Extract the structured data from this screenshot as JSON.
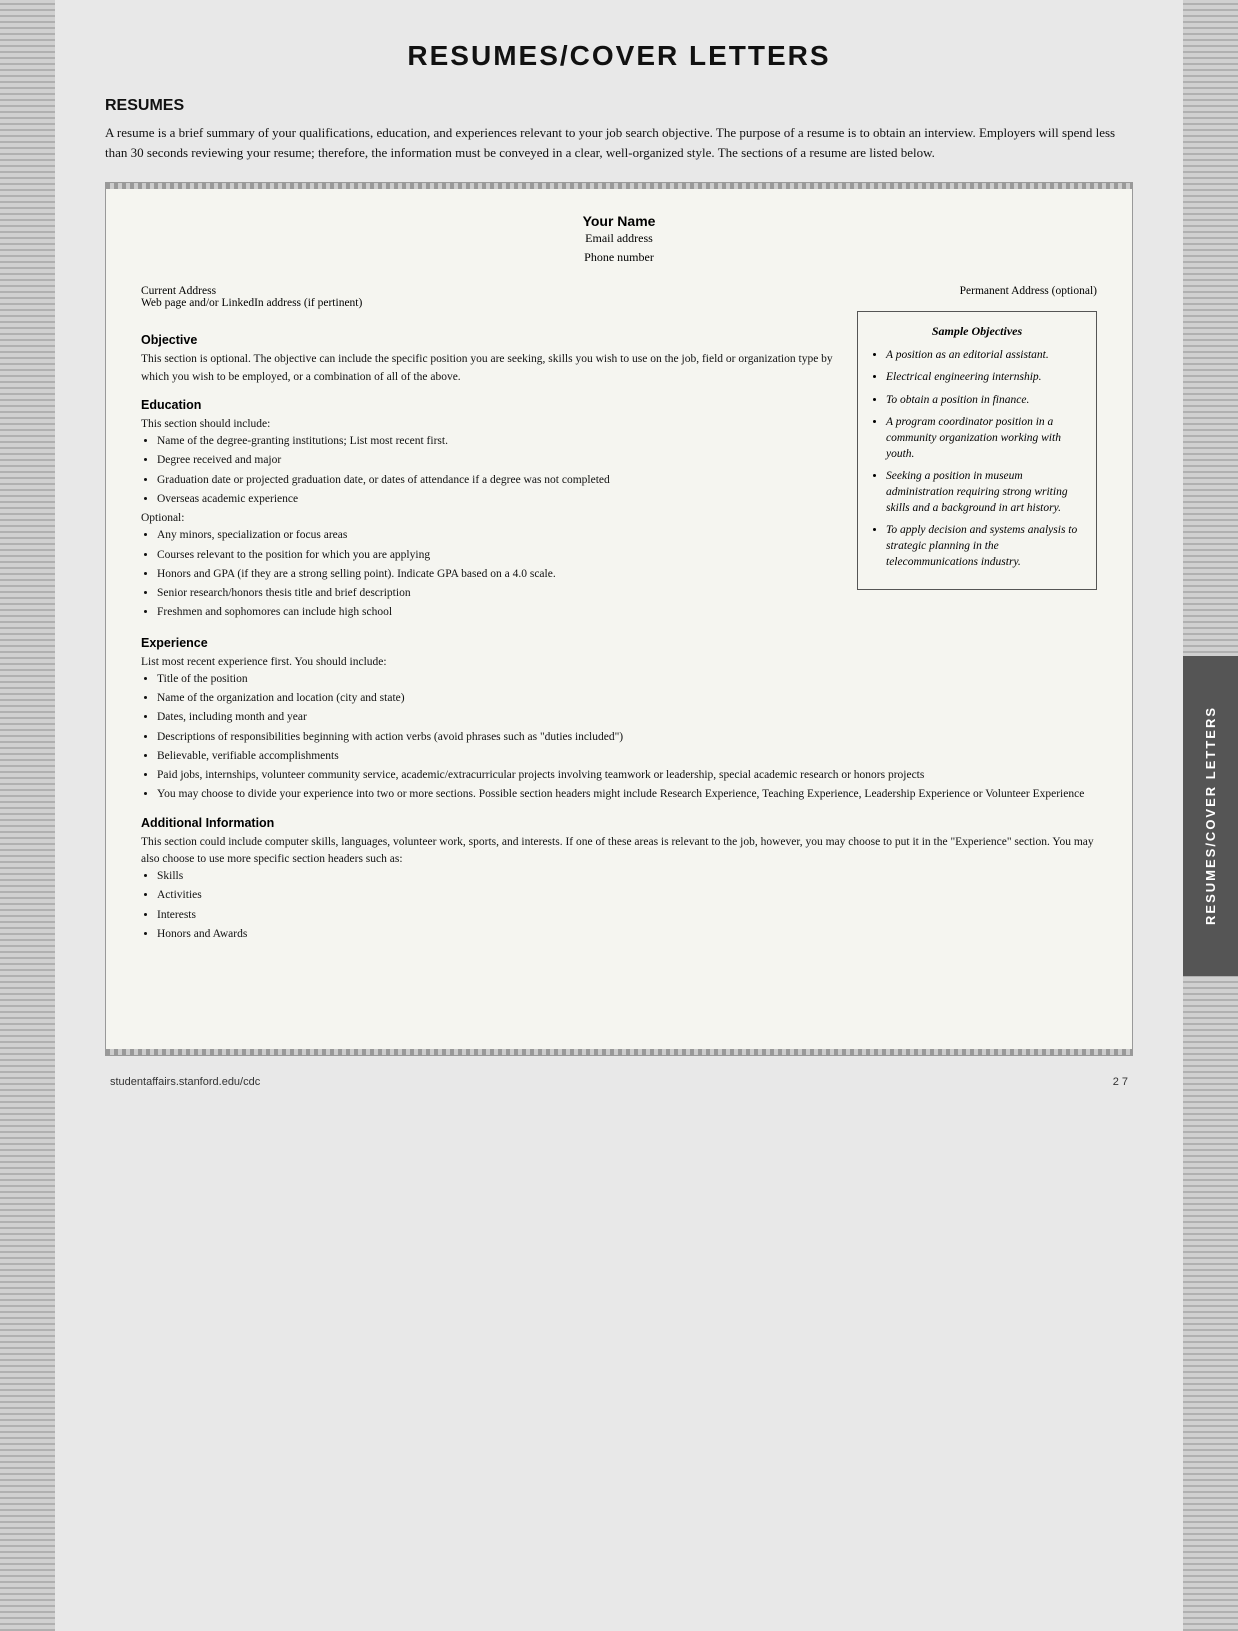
{
  "page": {
    "title": "RESUMES/COVER LETTERS",
    "footer": {
      "url": "studentaffairs.stanford.edu/cdc",
      "page": "2 7"
    }
  },
  "resumes_section": {
    "heading": "RESUMES",
    "intro": "A resume is a brief summary of your qualifications, education, and experiences relevant to your job search objective. The purpose of a resume is to obtain an interview. Employers will spend less than 30 seconds reviewing your resume; therefore, the information must be conveyed in a clear, well-organized style. The sections of a resume are listed below."
  },
  "resume_doc": {
    "name": "Your Name",
    "email": "Email address",
    "phone": "Phone number",
    "current_address": "Current Address",
    "linkedin": "Web page and/or LinkedIn address (if pertinent)",
    "permanent_address": "Permanent Address (optional)",
    "objective_heading": "Objective",
    "objective_text": "This section is optional. The objective can include the specific position you are seeking, skills you wish to use on the job, field or organization type by which you wish to be employed, or a combination of all of the above.",
    "education_heading": "Education",
    "education_intro": "This section should include:",
    "education_items": [
      "Name of the degree-granting institutions; List most recent first.",
      "Degree received and major",
      "Graduation date or projected graduation date, or dates of attendance if a degree was not completed",
      "Overseas academic experience"
    ],
    "education_optional_label": "Optional:",
    "education_optional_items": [
      "Any minors, specialization or focus areas",
      "Courses relevant to the position for which you are applying",
      "Honors and GPA (if they are a strong selling point). Indicate GPA based on a 4.0 scale.",
      "Senior research/honors thesis title and brief description",
      "Freshmen and sophomores can include high school"
    ],
    "experience_heading": "Experience",
    "experience_intro": "List most recent experience first. You should include:",
    "experience_items": [
      "Title of the position",
      "Name of the organization and location (city and state)",
      "Dates, including month and year",
      "Descriptions of responsibilities beginning with action verbs (avoid phrases such as \"duties included\")",
      "Believable, verifiable accomplishments",
      "Paid jobs, internships, volunteer community service, academic/extracurricular projects involving teamwork or leadership, special academic research or honors projects",
      "You may choose to divide your experience into two or more sections. Possible section headers might include Research Experience, Teaching Experience, Leadership Experience or Volunteer Experience"
    ],
    "additional_heading": "Additional Information",
    "additional_text": "This section could include computer skills, languages, volunteer work, sports, and interests. If one of these areas is relevant to the job, however, you may choose to put it in the \"Experience\" section. You may also choose to use more specific section headers such as:",
    "additional_items": [
      "Skills",
      "Activities",
      "Interests",
      "Honors and Awards"
    ]
  },
  "sample_objectives": {
    "title": "Sample Objectives",
    "items": [
      "A position as an editorial assistant.",
      "Electrical engineering internship.",
      "To obtain a position in finance.",
      "A program coordinator position in a community organization working with youth.",
      "Seeking a position in museum administration requiring strong writing skills and a background in art history.",
      "To apply decision and systems analysis to strategic planning in the telecommunications industry."
    ]
  },
  "side_tab": {
    "label": "RESUMES/COVER LETTERS"
  }
}
